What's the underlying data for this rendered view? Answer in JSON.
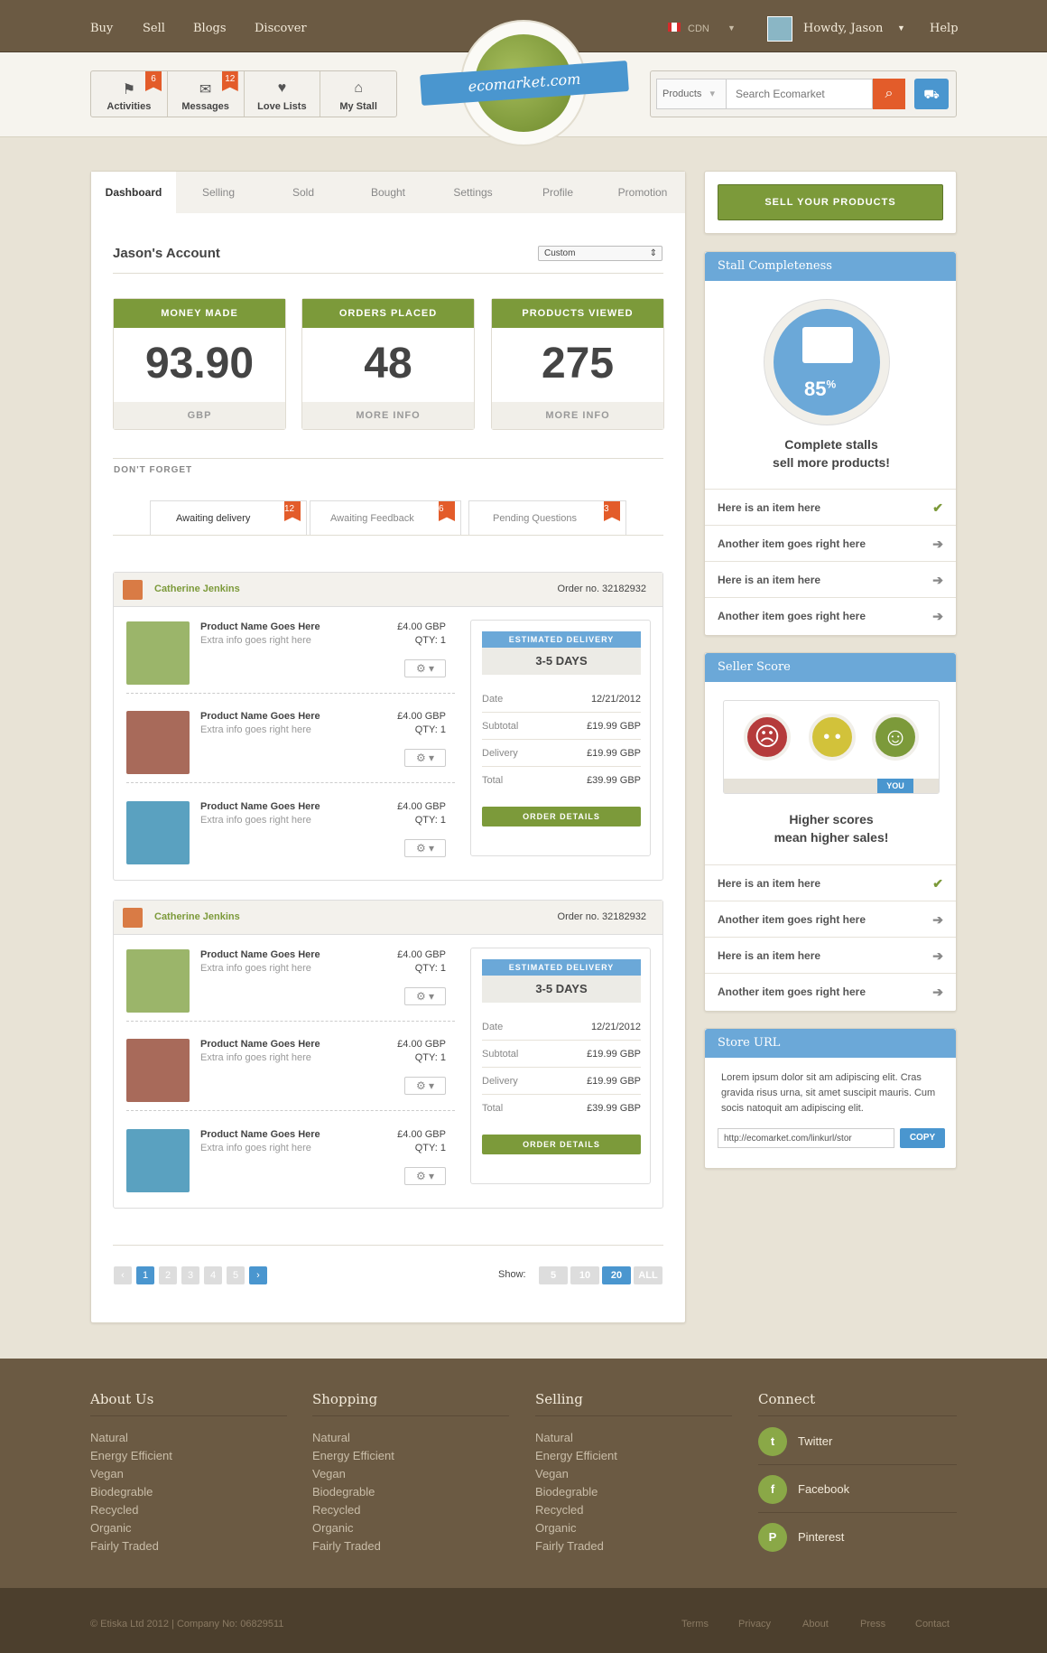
{
  "topnav": {
    "items": [
      "Buy",
      "Sell",
      "Blogs",
      "Discover"
    ],
    "currency": "CDN",
    "greeting": "Howdy, Jason",
    "help": "Help"
  },
  "toolbar": [
    {
      "label": "Activities",
      "badge": "6",
      "icon": "flag-icon"
    },
    {
      "label": "Messages",
      "badge": "12",
      "icon": "envelope-icon"
    },
    {
      "label": "Love Lists",
      "badge": "",
      "icon": "heart-icon"
    },
    {
      "label": "My Stall",
      "badge": "",
      "icon": "store-icon"
    }
  ],
  "logo": {
    "text": "ecomarket.com"
  },
  "search": {
    "category": "Products",
    "placeholder": "Search Ecomarket"
  },
  "tabs": [
    "Dashboard",
    "Selling",
    "Sold",
    "Bought",
    "Settings",
    "Profile",
    "Promotion"
  ],
  "account": {
    "title": "Jason's Account",
    "range": "Custom"
  },
  "stats": [
    {
      "title": "MONEY MADE",
      "value": "93.90",
      "foot": "GBP"
    },
    {
      "title": "ORDERS PLACED",
      "value": "48",
      "foot": "MORE INFO"
    },
    {
      "title": "PRODUCTS VIEWED",
      "value": "275",
      "foot": "MORE INFO"
    }
  ],
  "dont_forget": "DON'T FORGET",
  "subtabs": [
    {
      "label": "Awaiting delivery",
      "badge": "12"
    },
    {
      "label": "Awaiting Feedback",
      "badge": "6"
    },
    {
      "label": "Pending Questions",
      "badge": "3"
    }
  ],
  "orders": [
    {
      "customer": "Catherine Jenkins",
      "order_no": "Order no. 32182932",
      "products": [
        {
          "name": "Product Name Goes Here",
          "info": "Extra info goes right here",
          "price": "£4.00 GBP",
          "qty": "QTY: 1",
          "gear": "⚙ ▾"
        },
        {
          "name": "Product Name Goes Here",
          "info": "Extra info goes right here",
          "price": "£4.00 GBP",
          "qty": "QTY: 1",
          "gear": "⚙ ▾"
        },
        {
          "name": "Product Name Goes Here",
          "info": "Extra info goes right here",
          "price": "£4.00 GBP",
          "qty": "QTY: 1",
          "gear": "⚙ ▾"
        }
      ],
      "delivery": {
        "title": "ESTIMATED DELIVERY",
        "days": "3-5 DAYS",
        "rows": [
          [
            "Date",
            "12/21/2012"
          ],
          [
            "Subtotal",
            "£19.99 GBP"
          ],
          [
            "Delivery",
            "£19.99 GBP"
          ],
          [
            "Total",
            "£39.99 GBP"
          ]
        ],
        "button": "ORDER DETAILS"
      }
    },
    {
      "customer": "Catherine Jenkins",
      "order_no": "Order no. 32182932",
      "products": [
        {
          "name": "Product Name Goes Here",
          "info": "Extra info goes right here",
          "price": "£4.00 GBP",
          "qty": "QTY: 1",
          "gear": "⚙ ▾"
        },
        {
          "name": "Product Name Goes Here",
          "info": "Extra info goes right here",
          "price": "£4.00 GBP",
          "qty": "QTY: 1",
          "gear": "⚙ ▾"
        },
        {
          "name": "Product Name Goes Here",
          "info": "Extra info goes right here",
          "price": "£4.00 GBP",
          "qty": "QTY: 1",
          "gear": "⚙ ▾"
        }
      ],
      "delivery": {
        "title": "ESTIMATED DELIVERY",
        "days": "3-5 DAYS",
        "rows": [
          [
            "Date",
            "12/21/2012"
          ],
          [
            "Subtotal",
            "£19.99 GBP"
          ],
          [
            "Delivery",
            "£19.99 GBP"
          ],
          [
            "Total",
            "£39.99 GBP"
          ]
        ],
        "button": "ORDER DETAILS"
      }
    }
  ],
  "pagination": {
    "prev": "‹",
    "pages": [
      "1",
      "2",
      "3",
      "4",
      "5"
    ],
    "next": "›",
    "show_label": "Show:",
    "show": [
      "5",
      "10",
      "20",
      "ALL"
    ]
  },
  "sidebar": {
    "sell_button": "SELL YOUR PRODUCTS",
    "stall": {
      "title": "Stall Completeness",
      "percent": "85",
      "percent_sign": "%",
      "msg1": "Complete stalls",
      "msg2": "sell more products!",
      "items": [
        [
          "Here is an item here",
          "check"
        ],
        [
          "Another item goes right here",
          "arrow"
        ],
        [
          "Here is an item here",
          "arrow"
        ],
        [
          "Another item goes right here",
          "arrow"
        ]
      ]
    },
    "score": {
      "title": "Seller Score",
      "you": "YOU",
      "msg1": "Higher scores",
      "msg2": "mean higher sales!",
      "items": [
        [
          "Here is an item here",
          "check"
        ],
        [
          "Another item goes right here",
          "arrow"
        ],
        [
          "Here is an item here",
          "arrow"
        ],
        [
          "Another item goes right here",
          "arrow"
        ]
      ]
    },
    "store": {
      "title": "Store URL",
      "text": "Lorem ipsum dolor sit am adipiscing elit. Cras gravida risus urna, sit amet suscipit mauris. Cum socis natoquit am adipiscing elit.",
      "url": "http://ecomarket.com/linkurl/stor",
      "copy": "COPY"
    }
  },
  "footer": {
    "cols": [
      {
        "title": "About Us",
        "links": [
          "Natural",
          "Energy Efficient",
          "Vegan",
          "Biodegrable",
          "Recycled",
          "Organic",
          "Fairly Traded"
        ]
      },
      {
        "title": "Shopping",
        "links": [
          "Natural",
          "Energy Efficient",
          "Vegan",
          "Biodegrable",
          "Recycled",
          "Organic",
          "Fairly Traded"
        ]
      },
      {
        "title": "Selling",
        "links": [
          "Natural",
          "Energy Efficient",
          "Vegan",
          "Biodegrable",
          "Recycled",
          "Organic",
          "Fairly Traded"
        ]
      }
    ],
    "connect": {
      "title": "Connect",
      "items": [
        {
          "label": "Twitter",
          "glyph": "t"
        },
        {
          "label": "Facebook",
          "glyph": "f"
        },
        {
          "label": "Pinterest",
          "glyph": "P"
        }
      ]
    },
    "copyright": "© Etiska Ltd 2012 | Company No: 06829511",
    "links": [
      "Terms",
      "Privacy",
      "About",
      "Press",
      "Contact"
    ]
  }
}
